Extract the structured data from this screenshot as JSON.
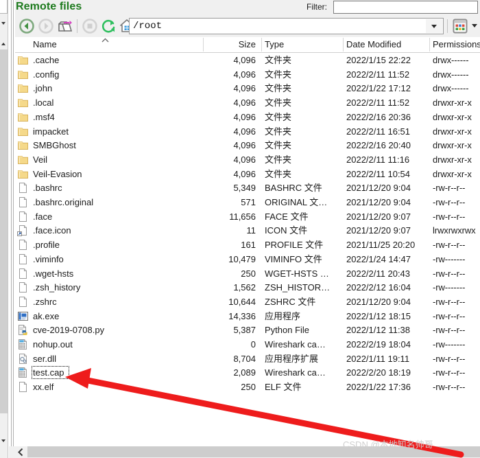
{
  "window": {
    "title": "Remote files",
    "title_color": "#1d7a1d"
  },
  "filter": {
    "label": "Filter:",
    "value": "",
    "placeholder": ""
  },
  "toolbar": {
    "back_label": "Back",
    "forward_label": "Forward",
    "parent_label": "Parent directory",
    "stop_label": "Stop",
    "refresh_label": "Refresh",
    "home_label": "Home",
    "path_value": "/root",
    "path_dropdown_label": "History",
    "view_mode_label": "View mode",
    "view_dropdown_label": "View options"
  },
  "list": {
    "columns": [
      {
        "key": "name",
        "label": "Name"
      },
      {
        "key": "size",
        "label": "Size"
      },
      {
        "key": "type",
        "label": "Type"
      },
      {
        "key": "date",
        "label": "Date Modified"
      },
      {
        "key": "perm",
        "label": "Permissions"
      }
    ],
    "sort": {
      "column": "Name",
      "direction": "asc",
      "indicator": "^"
    },
    "selected": "test.cap",
    "rows": [
      {
        "name": ".cache",
        "icon": "folder-icon",
        "size": "4,096",
        "type": "文件夹",
        "date": "2022/1/15 22:22",
        "perm": "drwx------"
      },
      {
        "name": ".config",
        "icon": "folder-icon",
        "size": "4,096",
        "type": "文件夹",
        "date": "2022/2/11 11:52",
        "perm": "drwx------"
      },
      {
        "name": ".john",
        "icon": "folder-icon",
        "size": "4,096",
        "type": "文件夹",
        "date": "2022/1/22 17:12",
        "perm": "drwx------"
      },
      {
        "name": ".local",
        "icon": "folder-icon",
        "size": "4,096",
        "type": "文件夹",
        "date": "2022/2/11 11:52",
        "perm": "drwxr-xr-x"
      },
      {
        "name": ".msf4",
        "icon": "folder-icon",
        "size": "4,096",
        "type": "文件夹",
        "date": "2022/2/16 20:36",
        "perm": "drwxr-xr-x"
      },
      {
        "name": "impacket",
        "icon": "folder-icon",
        "size": "4,096",
        "type": "文件夹",
        "date": "2022/2/11 16:51",
        "perm": "drwxr-xr-x"
      },
      {
        "name": "SMBGhost",
        "icon": "folder-icon",
        "size": "4,096",
        "type": "文件夹",
        "date": "2022/2/16 20:40",
        "perm": "drwxr-xr-x"
      },
      {
        "name": "Veil",
        "icon": "folder-icon",
        "size": "4,096",
        "type": "文件夹",
        "date": "2022/2/11 11:16",
        "perm": "drwxr-xr-x"
      },
      {
        "name": "Veil-Evasion",
        "icon": "folder-icon",
        "size": "4,096",
        "type": "文件夹",
        "date": "2022/2/11 10:54",
        "perm": "drwxr-xr-x"
      },
      {
        "name": ".bashrc",
        "icon": "file-icon",
        "size": "5,349",
        "type": "BASHRC 文件",
        "date": "2021/12/20 9:04",
        "perm": "-rw-r--r--"
      },
      {
        "name": ".bashrc.original",
        "icon": "file-icon",
        "size": "571",
        "type": "ORIGINAL 文…",
        "date": "2021/12/20 9:04",
        "perm": "-rw-r--r--"
      },
      {
        "name": ".face",
        "icon": "file-icon",
        "size": "11,656",
        "type": "FACE 文件",
        "date": "2021/12/20 9:07",
        "perm": "-rw-r--r--"
      },
      {
        "name": ".face.icon",
        "icon": "shortcut-icon",
        "size": "11",
        "type": "ICON 文件",
        "date": "2021/12/20 9:07",
        "perm": "lrwxrwxrwx"
      },
      {
        "name": ".profile",
        "icon": "file-icon",
        "size": "161",
        "type": "PROFILE 文件",
        "date": "2021/11/25 20:20",
        "perm": "-rw-r--r--"
      },
      {
        "name": ".viminfo",
        "icon": "file-icon",
        "size": "10,479",
        "type": "VIMINFO 文件",
        "date": "2022/1/24 14:47",
        "perm": "-rw-------"
      },
      {
        "name": ".wget-hsts",
        "icon": "file-icon",
        "size": "250",
        "type": "WGET-HSTS …",
        "date": "2022/2/11 20:43",
        "perm": "-rw-r--r--"
      },
      {
        "name": ".zsh_history",
        "icon": "file-icon",
        "size": "1,562",
        "type": "ZSH_HISTOR…",
        "date": "2022/2/12 16:04",
        "perm": "-rw-------"
      },
      {
        "name": ".zshrc",
        "icon": "file-icon",
        "size": "10,644",
        "type": "ZSHRC 文件",
        "date": "2021/12/20 9:04",
        "perm": "-rw-r--r--"
      },
      {
        "name": "ak.exe",
        "icon": "application-icon",
        "size": "14,336",
        "type": "应用程序",
        "date": "2022/1/12 18:15",
        "perm": "-rw-r--r--"
      },
      {
        "name": "cve-2019-0708.py",
        "icon": "python-file-icon",
        "size": "5,387",
        "type": "Python File",
        "date": "2022/1/12 11:38",
        "perm": "-rw-r--r--"
      },
      {
        "name": "nohup.out",
        "icon": "wireshark-icon",
        "size": "0",
        "type": "Wireshark ca…",
        "date": "2022/2/19 18:04",
        "perm": "-rw-------"
      },
      {
        "name": "ser.dll",
        "icon": "dll-icon",
        "size": "8,704",
        "type": "应用程序扩展",
        "date": "2022/1/11 19:11",
        "perm": "-rw-r--r--"
      },
      {
        "name": "test.cap",
        "icon": "wireshark-icon",
        "size": "2,089",
        "type": "Wireshark ca…",
        "date": "2022/2/20 18:19",
        "perm": "-rw-r--r--"
      },
      {
        "name": "xx.elf",
        "icon": "file-icon",
        "size": "250",
        "type": "ELF 文件",
        "date": "2022/1/22 17:36",
        "perm": "-rw-r--r--"
      }
    ]
  },
  "annotation": {
    "arrow_color": "#ee1c1c",
    "target": "test.cap"
  },
  "watermark": {
    "text": "CSDN @本地知名帅哥"
  }
}
